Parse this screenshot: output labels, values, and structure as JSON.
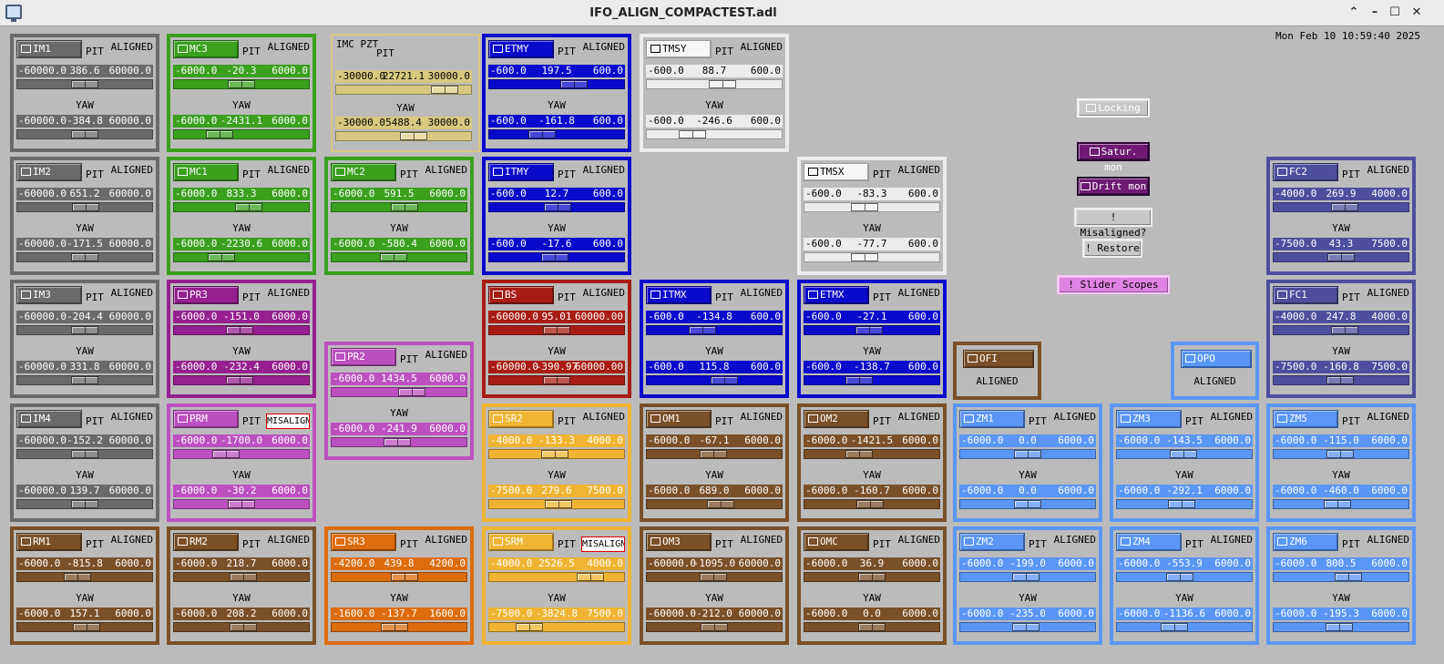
{
  "window": {
    "title": "IFO_ALIGN_COMPACTEST.adl"
  },
  "datetime": "Mon Feb 10 10:59:40 2025",
  "colors": {
    "gray": "#6a6a6a",
    "green": "#3aa01e",
    "khaki": "#d8c880",
    "blue": "#0a0acc",
    "white": "#ececec",
    "purple": "#962090",
    "magenta": "#bc50c0",
    "red": "#a81c14",
    "yellow": "#f0b432",
    "brown": "#7a5028",
    "orange": "#dc6c0c",
    "lightblue": "#5a96f6",
    "slate": "#4e4e9e"
  },
  "labels": {
    "pit": "PIT",
    "yaw": "YAW"
  },
  "panels": [
    {
      "name": "IM1",
      "status": "ALIGNED",
      "color": "gray",
      "pit": {
        "min": "-60000.0",
        "val": "386.6",
        "max": "60000.0",
        "pos": 0.503
      },
      "yaw": {
        "min": "-60000.0",
        "val": "-384.8",
        "max": "60000.0",
        "pos": 0.497
      }
    },
    {
      "name": "MC3",
      "status": "ALIGNED",
      "color": "green",
      "pit": {
        "min": "-6000.0",
        "val": "-20.3",
        "max": "6000.0",
        "pos": 0.498
      },
      "yaw": {
        "min": "-6000.0",
        "val": "-2431.1",
        "max": "6000.0",
        "pos": 0.297
      }
    },
    {
      "name": "ETMY",
      "status": "ALIGNED",
      "color": "blue",
      "pit": {
        "min": "-600.0",
        "val": "197.5",
        "max": "600.0",
        "pos": 0.665
      },
      "yaw": {
        "min": "-600.0",
        "val": "-161.8",
        "max": "600.0",
        "pos": 0.365
      }
    },
    {
      "name": "TMSY",
      "status": "ALIGNED",
      "color": "white",
      "pit": {
        "min": "-600.0",
        "val": "88.7",
        "max": "600.0",
        "pos": 0.574
      },
      "yaw": {
        "min": "-600.0",
        "val": "-246.6",
        "max": "600.0",
        "pos": 0.295
      }
    },
    {
      "name": "IM2",
      "status": "ALIGNED",
      "color": "gray",
      "pit": {
        "min": "-60000.0",
        "val": "651.2",
        "max": "60000.0",
        "pos": 0.505
      },
      "yaw": {
        "min": "-60000.0",
        "val": "-171.5",
        "max": "60000.0",
        "pos": 0.499
      }
    },
    {
      "name": "MC1",
      "status": "ALIGNED",
      "color": "green",
      "pit": {
        "min": "-6000.0",
        "val": "833.3",
        "max": "6000.0",
        "pos": 0.569
      },
      "yaw": {
        "min": "-6000.0",
        "val": "-2230.6",
        "max": "6000.0",
        "pos": 0.314
      }
    },
    {
      "name": "MC2",
      "status": "ALIGNED",
      "color": "green",
      "pit": {
        "min": "-6000.0",
        "val": "591.5",
        "max": "6000.0",
        "pos": 0.549
      },
      "yaw": {
        "min": "-6000.0",
        "val": "-580.4",
        "max": "6000.0",
        "pos": 0.452
      }
    },
    {
      "name": "ITMY",
      "status": "ALIGNED",
      "color": "blue",
      "pit": {
        "min": "-600.0",
        "val": "12.7",
        "max": "600.0",
        "pos": 0.51
      },
      "yaw": {
        "min": "-600.0",
        "val": "-17.6",
        "max": "600.0",
        "pos": 0.485
      }
    },
    {
      "name": "TMSX",
      "status": "ALIGNED",
      "color": "white",
      "pit": {
        "min": "-600.0",
        "val": "-83.3",
        "max": "600.0",
        "pos": 0.43
      },
      "yaw": {
        "min": "-600.0",
        "val": "-77.7",
        "max": "600.0",
        "pos": 0.435
      }
    },
    {
      "name": "FC2",
      "status": "ALIGNED",
      "color": "slate",
      "pit": {
        "min": "-4000.0",
        "val": "269.9",
        "max": "4000.0",
        "pos": 0.534
      },
      "yaw": {
        "min": "-7500.0",
        "val": "43.3",
        "max": "7500.0",
        "pos": 0.503
      }
    },
    {
      "name": "IM3",
      "status": "ALIGNED",
      "color": "gray",
      "pit": {
        "min": "-60000.0",
        "val": "-204.4",
        "max": "60000.0",
        "pos": 0.498
      },
      "yaw": {
        "min": "-60000.0",
        "val": "331.8",
        "max": "60000.0",
        "pos": 0.503
      }
    },
    {
      "name": "PR3",
      "status": "ALIGNED",
      "color": "purple",
      "pit": {
        "min": "-6000.0",
        "val": "-151.0",
        "max": "6000.0",
        "pos": 0.487
      },
      "yaw": {
        "min": "-6000.0",
        "val": "-232.4",
        "max": "6000.0",
        "pos": 0.481
      }
    },
    {
      "name": "BS",
      "status": "ALIGNED",
      "color": "red",
      "pit": {
        "min": "-60000.0",
        "val": "95.01",
        "max": "60000.00",
        "pos": 0.5
      },
      "yaw": {
        "min": "-60000.0",
        "val": "-390.97",
        "max": "60000.00",
        "pos": 0.497
      }
    },
    {
      "name": "ITMX",
      "status": "ALIGNED",
      "color": "blue",
      "pit": {
        "min": "-600.0",
        "val": "-134.8",
        "max": "600.0",
        "pos": 0.388
      },
      "yaw": {
        "min": "-600.0",
        "val": "115.8",
        "max": "600.0",
        "pos": 0.597
      }
    },
    {
      "name": "ETMX",
      "status": "ALIGNED",
      "color": "blue",
      "pit": {
        "min": "-600.0",
        "val": "-27.1",
        "max": "600.0",
        "pos": 0.477
      },
      "yaw": {
        "min": "-600.0",
        "val": "-138.7",
        "max": "600.0",
        "pos": 0.384
      }
    },
    {
      "name": "FC1",
      "status": "ALIGNED",
      "color": "slate",
      "pit": {
        "min": "-4000.0",
        "val": "247.8",
        "max": "4000.0",
        "pos": 0.531
      },
      "yaw": {
        "min": "-7500.0",
        "val": "-160.8",
        "max": "7500.0",
        "pos": 0.489
      }
    },
    {
      "name": "PR2",
      "status": "ALIGNED",
      "color": "magenta",
      "pit": {
        "min": "-6000.0",
        "val": "1434.5",
        "max": "6000.0",
        "pos": 0.62
      },
      "yaw": {
        "min": "-6000.0",
        "val": "-241.9",
        "max": "6000.0",
        "pos": 0.48
      }
    },
    {
      "name": "IM4",
      "status": "ALIGNED",
      "color": "gray",
      "pit": {
        "min": "-60000.0",
        "val": "-152.2",
        "max": "60000.0",
        "pos": 0.499
      },
      "yaw": {
        "min": "-60000.0",
        "val": "139.7",
        "max": "60000.0",
        "pos": 0.501
      }
    },
    {
      "name": "PRM",
      "status": "MISALIGNED",
      "color": "magenta",
      "pit": {
        "min": "-6000.0",
        "val": "-1700.0",
        "max": "6000.0",
        "pos": 0.358
      },
      "yaw": {
        "min": "-6000.0",
        "val": "-30.2",
        "max": "6000.0",
        "pos": 0.497
      }
    },
    {
      "name": "SR2",
      "status": "ALIGNED",
      "color": "yellow",
      "pit": {
        "min": "-4000.0",
        "val": "-133.3",
        "max": "4000.0",
        "pos": 0.483
      },
      "yaw": {
        "min": "-7500.0",
        "val": "279.6",
        "max": "7500.0",
        "pos": 0.519
      }
    },
    {
      "name": "OM1",
      "status": "ALIGNED",
      "color": "brown",
      "pit": {
        "min": "-6000.0",
        "val": "-67.1",
        "max": "6000.0",
        "pos": 0.494
      },
      "yaw": {
        "min": "-6000.0",
        "val": "689.0",
        "max": "6000.0",
        "pos": 0.557
      }
    },
    {
      "name": "OM2",
      "status": "ALIGNED",
      "color": "brown",
      "pit": {
        "min": "-6000.0",
        "val": "-1421.5",
        "max": "6000.0",
        "pos": 0.382
      },
      "yaw": {
        "min": "-6000.0",
        "val": "-160.7",
        "max": "6000.0",
        "pos": 0.487
      }
    },
    {
      "name": "ZM1",
      "status": "ALIGNED",
      "color": "lightblue",
      "pit": {
        "min": "-6000.0",
        "val": "0.0",
        "max": "6000.0",
        "pos": 0.5
      },
      "yaw": {
        "min": "-6000.0",
        "val": "0.0",
        "max": "6000.0",
        "pos": 0.5
      }
    },
    {
      "name": "ZM3",
      "status": "ALIGNED",
      "color": "lightblue",
      "pit": {
        "min": "-6000.0",
        "val": "-143.5",
        "max": "6000.0",
        "pos": 0.488
      },
      "yaw": {
        "min": "-6000.0",
        "val": "-292.1",
        "max": "6000.0",
        "pos": 0.476
      }
    },
    {
      "name": "ZM5",
      "status": "ALIGNED",
      "color": "lightblue",
      "pit": {
        "min": "-6000.0",
        "val": "-115.0",
        "max": "6000.0",
        "pos": 0.49
      },
      "yaw": {
        "min": "-6000.0",
        "val": "-460.0",
        "max": "6000.0",
        "pos": 0.462
      }
    },
    {
      "name": "RM1",
      "status": "ALIGNED",
      "color": "brown",
      "pit": {
        "min": "-6000.0",
        "val": "-815.8",
        "max": "6000.0",
        "pos": 0.432
      },
      "yaw": {
        "min": "-6000.0",
        "val": "157.1",
        "max": "6000.0",
        "pos": 0.513
      }
    },
    {
      "name": "RM2",
      "status": "ALIGNED",
      "color": "brown",
      "pit": {
        "min": "-6000.0",
        "val": "218.7",
        "max": "6000.0",
        "pos": 0.518
      },
      "yaw": {
        "min": "-6000.0",
        "val": "208.2",
        "max": "6000.0",
        "pos": 0.517
      }
    },
    {
      "name": "SR3",
      "status": "ALIGNED",
      "color": "orange",
      "pit": {
        "min": "-4200.0",
        "val": "439.8",
        "max": "4200.0",
        "pos": 0.552
      },
      "yaw": {
        "min": "-1600.0",
        "val": "-137.7",
        "max": "1600.0",
        "pos": 0.457
      }
    },
    {
      "name": "SRM",
      "status": "MISALIGNED",
      "color": "yellow",
      "pit": {
        "min": "-4000.0",
        "val": "2526.5",
        "max": "4000.0",
        "pos": 0.816
      },
      "yaw": {
        "min": "-7500.0",
        "val": "-3824.8",
        "max": "7500.0",
        "pos": 0.245
      }
    },
    {
      "name": "OM3",
      "status": "ALIGNED",
      "color": "brown",
      "pit": {
        "min": "-60000.0",
        "val": "-1095.0",
        "max": "60000.0",
        "pos": 0.491
      },
      "yaw": {
        "min": "-60000.0",
        "val": "-212.0",
        "max": "60000.0",
        "pos": 0.498
      }
    },
    {
      "name": "OMC",
      "status": "ALIGNED",
      "color": "brown",
      "pit": {
        "min": "-6000.0",
        "val": "36.9",
        "max": "6000.0",
        "pos": 0.503
      },
      "yaw": {
        "min": "-6000.0",
        "val": "0.0",
        "max": "6000.0",
        "pos": 0.5
      }
    },
    {
      "name": "ZM2",
      "status": "ALIGNED",
      "color": "lightblue",
      "pit": {
        "min": "-6000.0",
        "val": "-199.0",
        "max": "6000.0",
        "pos": 0.483
      },
      "yaw": {
        "min": "-6000.0",
        "val": "-235.0",
        "max": "6000.0",
        "pos": 0.48
      }
    },
    {
      "name": "ZM4",
      "status": "ALIGNED",
      "color": "lightblue",
      "pit": {
        "min": "-6000.0",
        "val": "-553.9",
        "max": "6000.0",
        "pos": 0.454
      },
      "yaw": {
        "min": "-6000.0",
        "val": "-1136.6",
        "max": "6000.0",
        "pos": 0.405
      }
    },
    {
      "name": "ZM6",
      "status": "ALIGNED",
      "color": "lightblue",
      "pit": {
        "min": "-6000.0",
        "val": "800.5",
        "max": "6000.0",
        "pos": 0.567
      },
      "yaw": {
        "min": "-6000.0",
        "val": "-195.3",
        "max": "6000.0",
        "pos": 0.484
      }
    }
  ],
  "imc_pzt": {
    "label": "IMC PZT",
    "pit": {
      "min": "-30000.0",
      "val": "22721.1",
      "max": "30000.0",
      "pos": 0.879
    },
    "yaw": {
      "min": "-30000.0",
      "val": "5488.4",
      "max": "30000.0",
      "pos": 0.591
    }
  },
  "ofi": {
    "name": "OFI",
    "status": "ALIGNED"
  },
  "opo": {
    "name": "OPO",
    "status": "ALIGNED"
  },
  "controls": {
    "locking": "Locking",
    "satur": "Satur. mon",
    "drift": "Drift mon",
    "misaligned": "! Misaligned?",
    "restore": "! Restore",
    "scopes": "! Slider Scopes"
  }
}
